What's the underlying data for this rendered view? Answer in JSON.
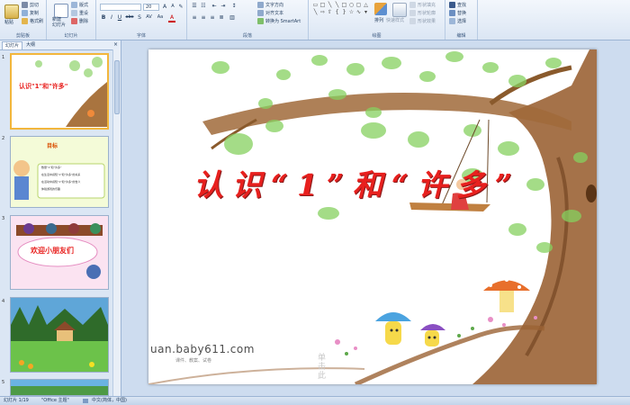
{
  "ribbon": {
    "clipboard": {
      "paste": "粘贴",
      "cut": "剪切",
      "copy": "复制",
      "format_painter": "格式刷",
      "label": "剪贴板"
    },
    "slides": {
      "new_slide": "新建\n幻灯片",
      "layout": "版式",
      "reset": "重设",
      "delete": "删除",
      "label": "幻灯片"
    },
    "font": {
      "font_name": "",
      "font_size": "20",
      "bold": "B",
      "italic": "I",
      "underline": "U",
      "strike": "abc",
      "shadow": "S",
      "spacing": "AV",
      "case": "Aa",
      "color": "A",
      "label": "字体"
    },
    "paragraph": {
      "text_direction": "文字方向",
      "align_text": "对齐文本",
      "smartart": "转换为 SmartArt",
      "label": "段落"
    },
    "drawing": {
      "arrange": "排列",
      "quick_styles": "快速样式",
      "fill": "形状填充",
      "outline": "形状轮廓",
      "effects": "形状效果",
      "label": "绘图"
    },
    "editing": {
      "find": "查找",
      "replace": "替换",
      "select": "选择",
      "label": "编辑"
    }
  },
  "panel": {
    "tab_slides": "幻灯片",
    "tab_outline": "大纲",
    "close": "×",
    "thumbs": [
      {
        "num": "1",
        "title": "认识\"1\"和\"许多\""
      },
      {
        "num": "2",
        "title": "目标",
        "items": [
          "数量\"1\"和\"许多\"",
          "在生活中感知\"1\"和\"许多\"的关系",
          "在活动中感知\"1\"和\"许多\"的含义",
          "体验游戏的乐趣"
        ]
      },
      {
        "num": "3",
        "title": "欢迎小朋友们"
      },
      {
        "num": "4"
      },
      {
        "num": "5"
      }
    ]
  },
  "slide": {
    "title": "认识“1”和“许多”",
    "watermark": "uan.baby611.com",
    "watermark_small": "课件、教案、试卷",
    "watermark_chars": "单\n击\n此"
  },
  "status": {
    "slide_counter": "幻灯片 1/19",
    "theme": "\"Office 主题\"",
    "language": "中文(简体，中国)"
  },
  "colors": {
    "title_red": "#e8201e",
    "ribbon_bg": "#dbe6f4",
    "selected_border": "#f2b63c"
  }
}
